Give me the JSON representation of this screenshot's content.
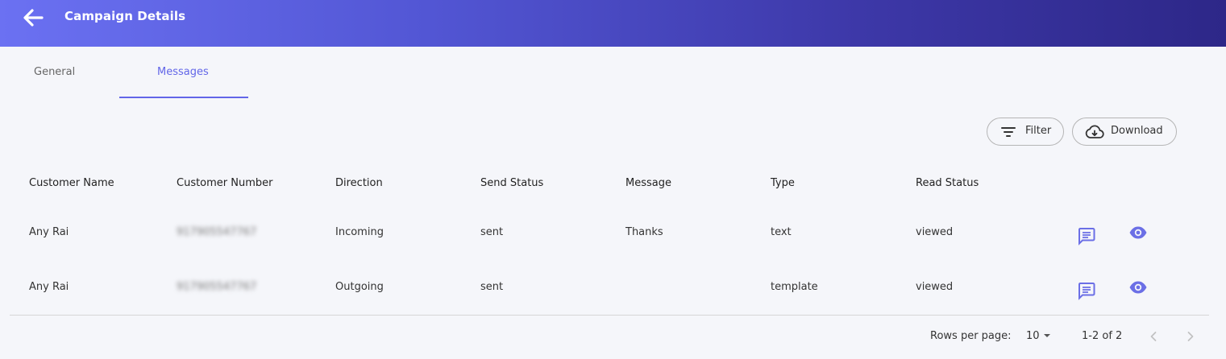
{
  "header": {
    "title": "Campaign Details",
    "back_icon": "arrow-left-icon"
  },
  "tabs": [
    {
      "label": "General",
      "active": false
    },
    {
      "label": "Messages",
      "active": true
    }
  ],
  "toolbar": {
    "filter_label": "Filter",
    "filter_icon": "filter-icon",
    "download_label": "Download",
    "download_icon": "cloud-download-icon"
  },
  "table": {
    "columns": [
      "Customer Name",
      "Customer Number",
      "Direction",
      "Send Status",
      "Message",
      "Type",
      "Read Status"
    ],
    "rows": [
      {
        "customer_name": "Any Rai",
        "customer_number": "917905547767",
        "direction": "Incoming",
        "send_status": "sent",
        "message": "Thanks",
        "type": "text",
        "read_status": "viewed"
      },
      {
        "customer_name": "Any Rai",
        "customer_number": "917905547767",
        "direction": "Outgoing",
        "send_status": "sent",
        "message": "",
        "type": "template",
        "read_status": "viewed"
      }
    ],
    "row_actions": [
      "chat-icon",
      "eye-icon"
    ]
  },
  "pagination": {
    "rows_per_page_label": "Rows per page:",
    "rows_per_page_value": "10",
    "range_text": "1-2 of 2"
  },
  "colors": {
    "accent": "#6266e8",
    "header_start": "#6b71f2",
    "header_end": "#2d2788",
    "icon": "#6b6fe6"
  }
}
